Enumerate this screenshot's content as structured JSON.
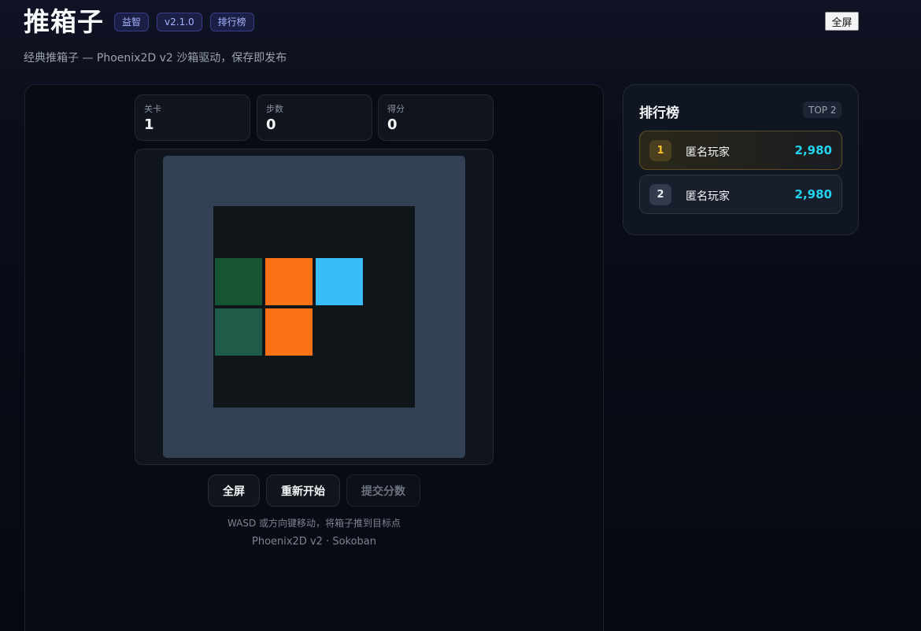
{
  "header": {
    "title": "推箱子",
    "badges": [
      "益智",
      "v2.1.0",
      "排行榜"
    ],
    "subtitle": "经典推箱子 — Phoenix2D v2 沙箱驱动，保存即发布",
    "fullscreen_label": "全屏"
  },
  "stats": [
    {
      "label": "关卡",
      "value": "1"
    },
    {
      "label": "步数",
      "value": "0"
    },
    {
      "label": "得分",
      "value": "0"
    }
  ],
  "board": {
    "colors": {
      "board": "#334155",
      "floor": "#0f1519",
      "box": "#f97316",
      "player": "#38bdf8",
      "target_a": "#165534",
      "target_b": "#1e5b49"
    },
    "tiles": [
      {
        "type": "target",
        "row": 1,
        "col": 0,
        "color": "#165534"
      },
      {
        "type": "box",
        "row": 1,
        "col": 1,
        "color": "#f97316"
      },
      {
        "type": "player",
        "row": 1,
        "col": 2,
        "color": "#38bdf8"
      },
      {
        "type": "target",
        "row": 2,
        "col": 0,
        "color": "#1e5b49"
      },
      {
        "type": "box",
        "row": 2,
        "col": 1,
        "color": "#f97316"
      }
    ]
  },
  "controls": {
    "fullscreen": "全屏",
    "restart": "重新开始",
    "submit": "提交分数"
  },
  "hint": "WASD 或方向键移动，将箱子推到目标点",
  "footer": "Phoenix2D v2 · Sokoban",
  "leaderboard": {
    "title": "排行榜",
    "badge": "TOP 2",
    "entries": [
      {
        "rank": "1",
        "name": "匿名玩家",
        "score": "2,980"
      },
      {
        "rank": "2",
        "name": "匿名玩家",
        "score": "2,980"
      }
    ]
  }
}
